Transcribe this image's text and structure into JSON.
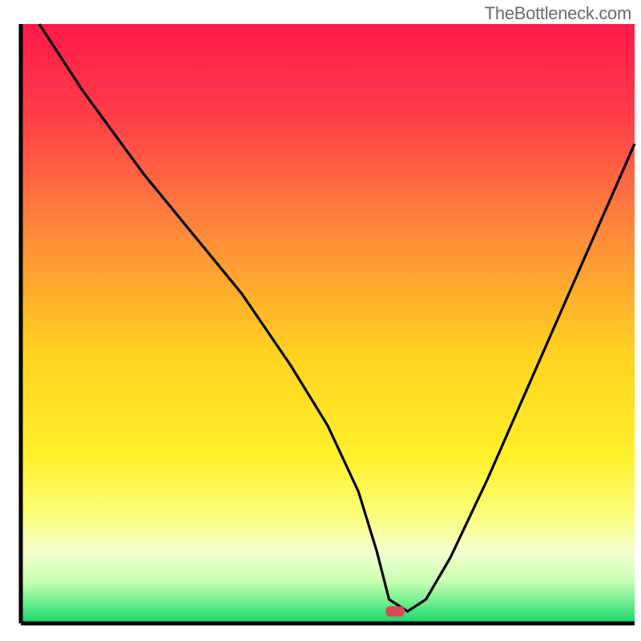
{
  "watermark": "TheBottleneck.com",
  "chart_data": {
    "type": "line",
    "title": "",
    "xlabel": "",
    "ylabel": "",
    "xlim": [
      0,
      100
    ],
    "ylim": [
      0,
      100
    ],
    "notes": "V-shaped bottleneck curve over a vertical red→yellow→green gradient. Minimum (optimal point) marked by a small red pill near the bottom around x≈61. No axis ticks or numeric labels are shown.",
    "series": [
      {
        "name": "bottleneck-curve",
        "x": [
          3,
          10,
          20,
          28,
          36,
          44,
          50,
          55,
          58,
          60,
          63,
          66,
          70,
          76,
          82,
          88,
          94,
          100
        ],
        "y": [
          100,
          89,
          75,
          65,
          55,
          43,
          33,
          22,
          12,
          4,
          2,
          4,
          11,
          24,
          38,
          52,
          66,
          80
        ]
      }
    ],
    "optimal_marker": {
      "x": 61,
      "y": 2
    },
    "gradient_stops": [
      {
        "offset": 0.0,
        "color": "#ff1a4b"
      },
      {
        "offset": 0.15,
        "color": "#ff3c4a"
      },
      {
        "offset": 0.35,
        "color": "#ff8a3a"
      },
      {
        "offset": 0.55,
        "color": "#ffd21f"
      },
      {
        "offset": 0.72,
        "color": "#fff02a"
      },
      {
        "offset": 0.82,
        "color": "#fbff7a"
      },
      {
        "offset": 0.88,
        "color": "#f5ffcf"
      },
      {
        "offset": 0.93,
        "color": "#c8ffb3"
      },
      {
        "offset": 0.965,
        "color": "#6eee8f"
      },
      {
        "offset": 1.0,
        "color": "#17d36a"
      }
    ],
    "axis_color": "#000000",
    "curve_color": "#000000",
    "marker_color": "#d94a56"
  }
}
